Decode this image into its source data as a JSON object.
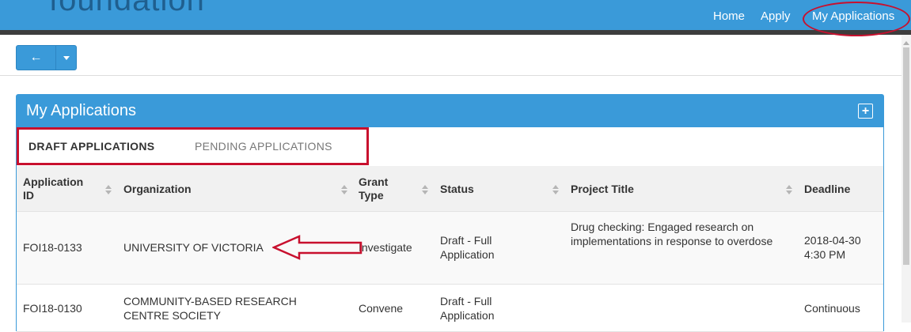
{
  "header": {
    "logo_text": "foundation",
    "nav": [
      {
        "label": "Home"
      },
      {
        "label": "Apply"
      },
      {
        "label": "My Applications"
      }
    ]
  },
  "toolbar": {
    "back_icon": "←"
  },
  "panel": {
    "title": "My Applications",
    "add_icon": "+",
    "tabs": [
      {
        "label": "DRAFT APPLICATIONS",
        "active": true
      },
      {
        "label": "PENDING APPLICATIONS",
        "active": false
      }
    ]
  },
  "table": {
    "columns": [
      {
        "label": "Application ID"
      },
      {
        "label": "Organization"
      },
      {
        "label": "Grant Type"
      },
      {
        "label": "Status"
      },
      {
        "label": "Project Title"
      },
      {
        "label": "Deadline"
      }
    ],
    "rows": [
      {
        "id": "FOI18-0133",
        "organization": "UNIVERSITY OF VICTORIA",
        "grant_type": "Investigate",
        "status": "Draft - Full Application",
        "project_title": "Drug checking: Engaged research on implementations in response to overdose",
        "deadline": "2018-04-30 4:30 PM"
      },
      {
        "id": "FOI18-0130",
        "organization": "COMMUNITY-BASED RESEARCH CENTRE SOCIETY",
        "grant_type": "Convene",
        "status": "Draft - Full Application",
        "project_title": "",
        "deadline": "Continuous"
      }
    ]
  },
  "colors": {
    "brand_blue": "#3a9ad9",
    "annotation_red": "#c8102e",
    "header_dark": "#3d3d3d"
  },
  "icons": [
    "back-arrow-icon",
    "chevron-down-icon",
    "plus-icon",
    "sort-icon"
  ]
}
